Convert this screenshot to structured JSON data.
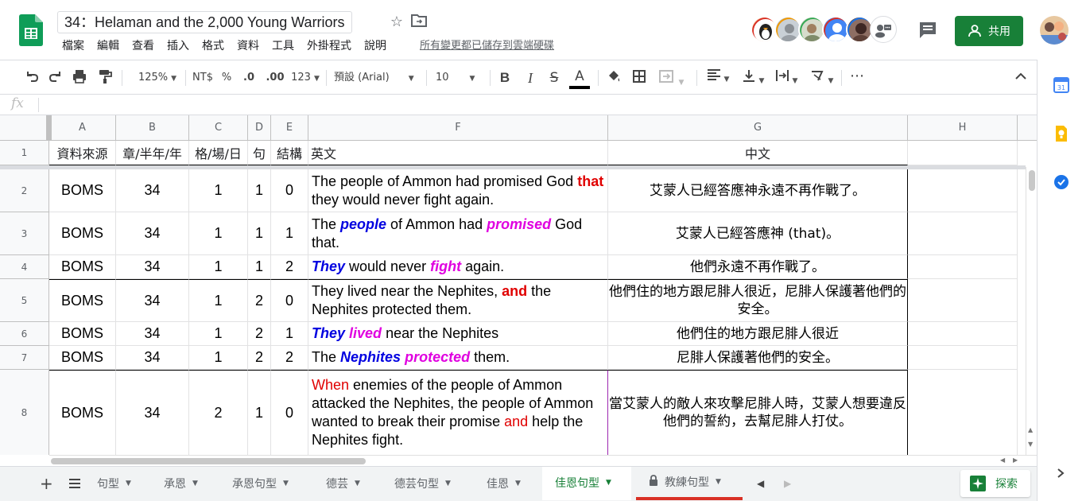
{
  "doc": {
    "title": "34：Helaman and the 2,000 Young Warriors",
    "save_status": "所有變更都已儲存到雲端硬碟"
  },
  "menu": [
    "檔案",
    "編輯",
    "查看",
    "插入",
    "格式",
    "資料",
    "工具",
    "外掛程式",
    "說明"
  ],
  "share_label": "共用",
  "toolbar": {
    "zoom": "125%",
    "currency": "NT$",
    "percent": "%",
    "dec_decrease": ".0",
    "dec_increase": ".00",
    "more_formats": "123",
    "font": "預設 (Arial)",
    "font_size": "10",
    "bold": "B",
    "italic": "I",
    "strike": "S",
    "text_color": "A",
    "more": "⋯"
  },
  "formula_bar": {
    "label": "fx",
    "value": ""
  },
  "columns": [
    "A",
    "B",
    "C",
    "D",
    "E",
    "F",
    "G",
    "H"
  ],
  "header_row": {
    "row": "1",
    "cells": [
      "資料來源",
      "章/半年/年",
      "格/場/日",
      "句",
      "結構",
      "英文",
      "中文"
    ]
  },
  "rows": [
    {
      "row": "2",
      "source": "BOMS",
      "chapter": "34",
      "grid": "1",
      "sentence": "1",
      "structure": "0",
      "english": [
        [
          "The people of Ammon had promised God ",
          ""
        ],
        [
          "that",
          "r"
        ],
        [
          " they would never fight again.",
          ""
        ]
      ],
      "chinese": "艾蒙人已經答應神永遠不再作戰了。"
    },
    {
      "row": "3",
      "source": "BOMS",
      "chapter": "34",
      "grid": "1",
      "sentence": "1",
      "structure": "1",
      "english": [
        [
          "The ",
          ""
        ],
        [
          "people",
          "b"
        ],
        [
          " of Ammon had ",
          ""
        ],
        [
          "promised",
          "m"
        ],
        [
          " God that.",
          ""
        ]
      ],
      "chinese": "艾蒙人已經答應神 (that)。"
    },
    {
      "row": "4",
      "source": "BOMS",
      "chapter": "34",
      "grid": "1",
      "sentence": "1",
      "structure": "2",
      "english": [
        [
          "They",
          "b"
        ],
        [
          " would never ",
          ""
        ],
        [
          "fight",
          "m"
        ],
        [
          " again.",
          ""
        ]
      ],
      "chinese": "他們永遠不再作戰了。"
    },
    {
      "row": "5",
      "source": "BOMS",
      "chapter": "34",
      "grid": "1",
      "sentence": "2",
      "structure": "0",
      "english": [
        [
          "They lived near the Nephites, ",
          ""
        ],
        [
          "and",
          "r"
        ],
        [
          " the Nephites protected them.",
          ""
        ]
      ],
      "chinese": "他們住的地方跟尼腓人很近，尼腓人保護著他們的安全。"
    },
    {
      "row": "6",
      "source": "BOMS",
      "chapter": "34",
      "grid": "1",
      "sentence": "2",
      "structure": "1",
      "english": [
        [
          "They",
          "b"
        ],
        [
          " ",
          ""
        ],
        [
          "lived",
          "m"
        ],
        [
          " near the Nephites",
          ""
        ]
      ],
      "chinese": "他們住的地方跟尼腓人很近"
    },
    {
      "row": "7",
      "source": "BOMS",
      "chapter": "34",
      "grid": "1",
      "sentence": "2",
      "structure": "2",
      "english": [
        [
          "The ",
          ""
        ],
        [
          "Nephites",
          "b"
        ],
        [
          " ",
          ""
        ],
        [
          "protected",
          "m"
        ],
        [
          " them.",
          ""
        ]
      ],
      "chinese": "尼腓人保護著他們的安全。"
    },
    {
      "row": "8",
      "source": "BOMS",
      "chapter": "34",
      "grid": "2",
      "sentence": "1",
      "structure": "0",
      "english": [
        [
          "When",
          "rn"
        ],
        [
          " enemies of the people of Ammon attacked the Nephites, the people of Ammon wanted to break their promise ",
          ""
        ],
        [
          "and",
          "rn"
        ],
        [
          " help the Nephites fight.",
          ""
        ]
      ],
      "chinese": "當艾蒙人的敵人來攻擊尼腓人時，艾蒙人想要違反他們的誓約，去幫尼腓人打仗。"
    }
  ],
  "tabs": [
    {
      "label": "句型",
      "active": false
    },
    {
      "label": "承恩",
      "active": false
    },
    {
      "label": "承恩句型",
      "active": false
    },
    {
      "label": "德芸",
      "active": false
    },
    {
      "label": "德芸句型",
      "active": false
    },
    {
      "label": "佳恩",
      "active": false
    },
    {
      "label": "佳恩句型",
      "active": true
    },
    {
      "label": "教練句型",
      "active": false,
      "locked": true
    }
  ],
  "explore_label": "探索",
  "colors": {
    "green": "#188038",
    "highlight_red": "#e00000",
    "highlight_blue": "#0000e0",
    "highlight_magenta": "#e000e0"
  }
}
